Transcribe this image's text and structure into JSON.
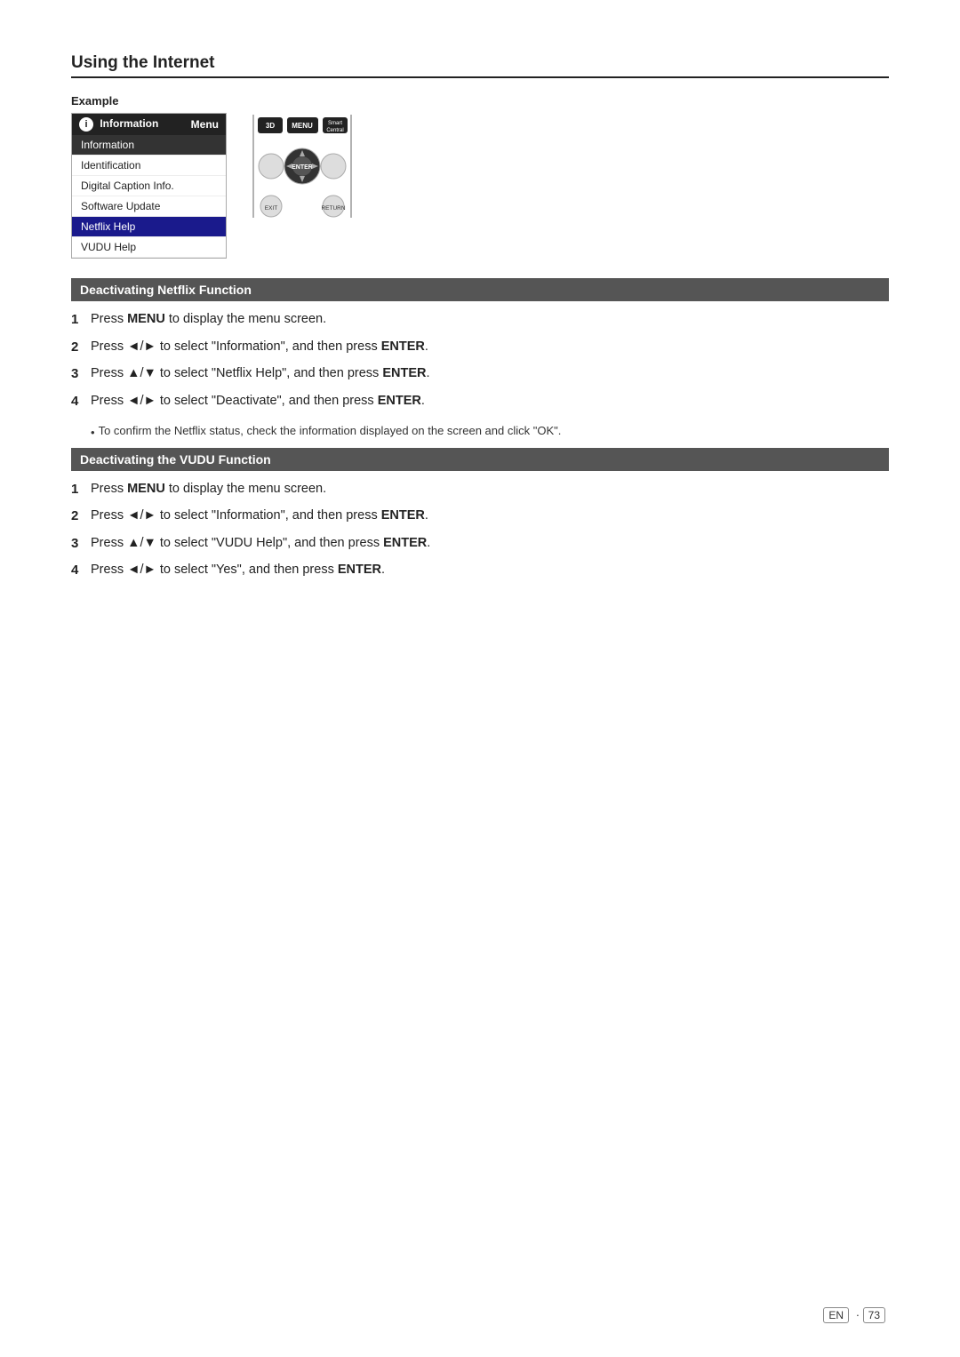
{
  "page": {
    "title": "Using the Internet",
    "example_label": "Example",
    "footer": {
      "lang": "EN",
      "page_number": "73"
    }
  },
  "menu": {
    "header_icon": "i",
    "header_label": "Information",
    "header_menu": "Menu",
    "items": [
      {
        "label": "Information",
        "type": "section"
      },
      {
        "label": "Identification",
        "type": "item"
      },
      {
        "label": "Digital Caption Info.",
        "type": "item"
      },
      {
        "label": "Software Update",
        "type": "item"
      },
      {
        "label": "Netflix Help",
        "type": "highlighted"
      },
      {
        "label": "VUDU Help",
        "type": "item"
      }
    ]
  },
  "remote": {
    "buttons": [
      "3D",
      "MENU",
      "Smart Central",
      "EXIT",
      "ENTER",
      "RETURN"
    ]
  },
  "netflix_section": {
    "title": "Deactivating Netflix Function",
    "steps": [
      {
        "number": "1",
        "text_before": "Press ",
        "bold": "MENU",
        "text_after": " to display the menu screen."
      },
      {
        "number": "2",
        "text_before": "Press ◄/► to select \"Information\", and then press ",
        "bold": "ENTER",
        "text_after": "."
      },
      {
        "number": "3",
        "text_before": "Press ▲/▼ to select \"Netflix Help\", and then press ",
        "bold": "ENTER",
        "text_after": "."
      },
      {
        "number": "4",
        "text_before": "Press ◄/► to select \"Deactivate\", and then press ",
        "bold": "ENTER",
        "text_after": "."
      }
    ],
    "note": "To confirm the Netflix status, check the information displayed on the screen and click \"OK\"."
  },
  "vudu_section": {
    "title": "Deactivating the VUDU Function",
    "steps": [
      {
        "number": "1",
        "text_before": "Press ",
        "bold": "MENU",
        "text_after": " to display the menu screen."
      },
      {
        "number": "2",
        "text_before": "Press ◄/► to select \"Information\", and then press ",
        "bold": "ENTER",
        "text_after": "."
      },
      {
        "number": "3",
        "text_before": "Press ▲/▼ to select \"VUDU Help\", and then press ",
        "bold": "ENTER",
        "text_after": "."
      },
      {
        "number": "4",
        "text_before": "Press ◄/► to select \"Yes\", and then press ",
        "bold": "ENTER",
        "text_after": "."
      }
    ]
  }
}
